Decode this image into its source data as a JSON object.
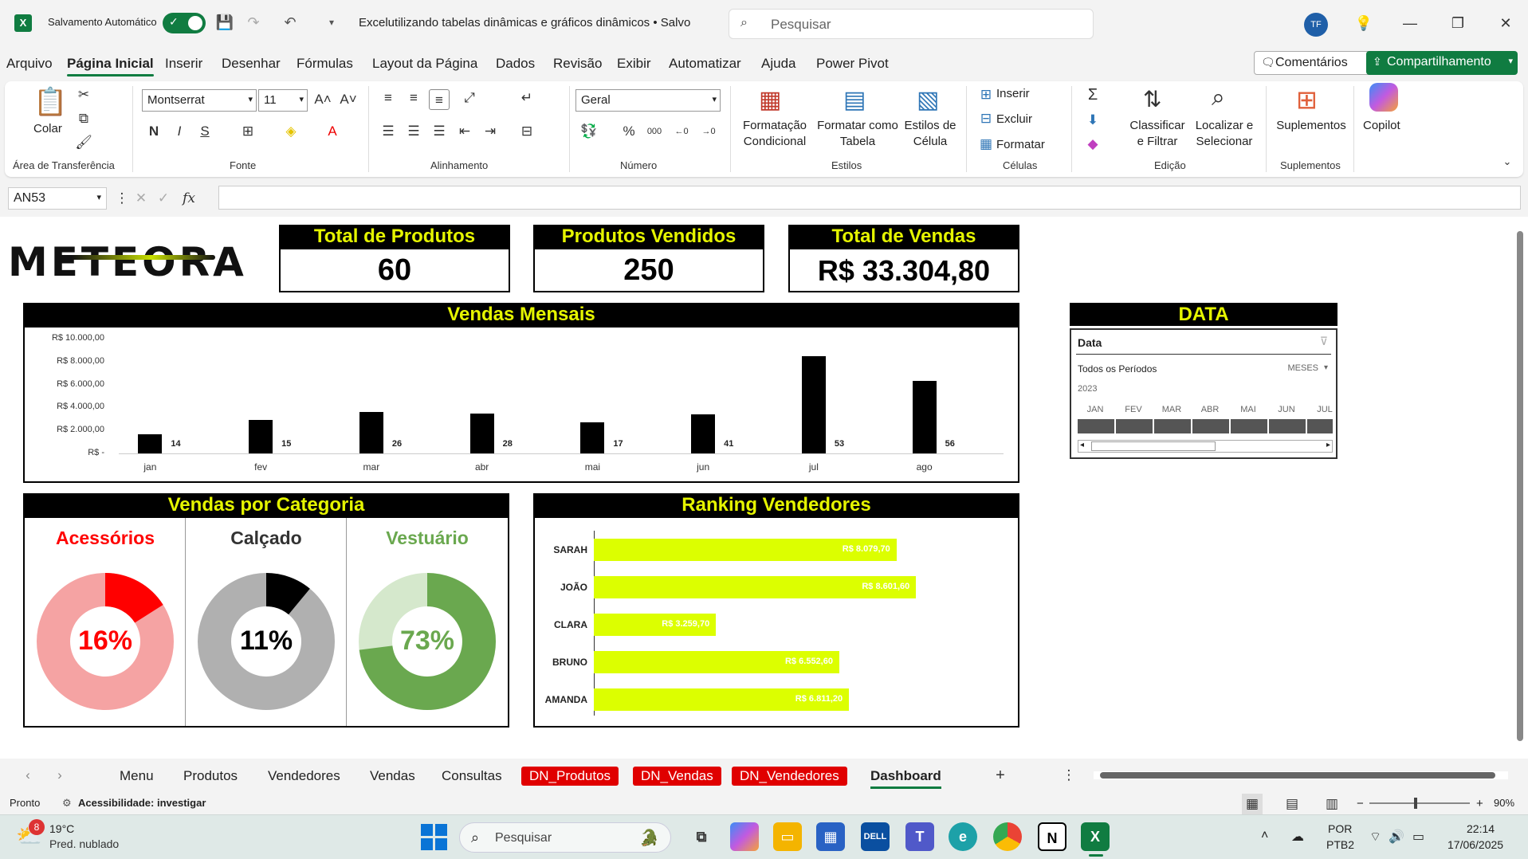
{
  "titlebar": {
    "autosave_label": "Salvamento Automático",
    "doc_title": "Excelutilizando tabelas dinâmicas e gráficos dinâmicos • Salvo",
    "search_placeholder": "Pesquisar",
    "avatar_initials": "TF"
  },
  "menu": {
    "items": [
      "Arquivo",
      "Página Inicial",
      "Inserir",
      "Desenhar",
      "Fórmulas",
      "Layout da Página",
      "Dados",
      "Revisão",
      "Exibir",
      "Automatizar",
      "Ajuda",
      "Power Pivot"
    ],
    "active": "Página Inicial",
    "comments_label": "Comentários",
    "share_label": "Compartilhamento"
  },
  "ribbon": {
    "paste_label": "Colar",
    "group_clipboard": "Área de Transferência",
    "font_name": "Montserrat",
    "font_size": "11",
    "group_font": "Fonte",
    "bold": "N",
    "italic": "I",
    "underline": "S",
    "group_alignment": "Alinhamento",
    "number_format": "Geral",
    "group_number": "Número",
    "cond_format": "Formatação Condicional",
    "format_table": "Formatar como Tabela",
    "cell_styles": "Estilos de Célula",
    "group_styles": "Estilos",
    "insert": "Inserir",
    "delete": "Excluir",
    "format": "Formatar",
    "group_cells": "Células",
    "sort_filter": "Classificar e Filtrar",
    "find_select": "Localizar e Selecionar",
    "group_editing": "Edição",
    "addins": "Suplementos",
    "group_addins": "Suplementos",
    "copilot": "Copilot"
  },
  "formula_bar": {
    "name_box": "AN53",
    "fx": "fx",
    "value": ""
  },
  "dashboard": {
    "logo": "METEORA",
    "kpis": [
      {
        "title": "Total de Produtos",
        "value": "60"
      },
      {
        "title": "Produtos Vendidos",
        "value": "250"
      },
      {
        "title": "Total de Vendas",
        "value": "R$ 33.304,80"
      }
    ],
    "monthly_title": "Vendas Mensais",
    "category_title": "Vendas por Categoria",
    "ranking_title": "Ranking Vendedores",
    "slicer_header": "DATA",
    "slicer": {
      "title": "Data",
      "all_periods": "Todos os Períodos",
      "level": "MESES",
      "year": "2023",
      "months": [
        "JAN",
        "FEV",
        "MAR",
        "ABR",
        "MAI",
        "JUN",
        "JUL"
      ]
    }
  },
  "chart_data": [
    {
      "type": "bar",
      "title": "Vendas Mensais",
      "categories": [
        "jan",
        "fev",
        "mar",
        "abr",
        "mai",
        "jun",
        "jul",
        "ago"
      ],
      "values": [
        1700,
        2950,
        3600,
        3500,
        2700,
        3400,
        8500,
        6300
      ],
      "data_labels": [
        "14",
        "15",
        "26",
        "28",
        "17",
        "41",
        "53",
        "56"
      ],
      "yticks": [
        "R$ -",
        "R$ 2.000,00",
        "R$ 4.000,00",
        "R$ 6.000,00",
        "R$ 8.000,00",
        "R$ 10.000,00"
      ],
      "ylim": [
        0,
        10000
      ],
      "bar_color": "#000000"
    },
    {
      "type": "pie",
      "title": "Vendas por Categoria",
      "slices": [
        {
          "name": "Acessórios",
          "value": 16,
          "label": "16%",
          "color": "#ff0000",
          "rest_color": "#f5a3a3"
        },
        {
          "name": "Calçado",
          "value": 11,
          "label": "11%",
          "color": "#000000",
          "rest_color": "#b0b0b0"
        },
        {
          "name": "Vestuário",
          "value": 73,
          "label": "73%",
          "color": "#6aa84f",
          "rest_color": "#d5e8cc"
        }
      ]
    },
    {
      "type": "bar",
      "title": "Ranking Vendedores",
      "categories": [
        "SARAH",
        "JOÃO",
        "CLARA",
        "BRUNO",
        "AMANDA"
      ],
      "values": [
        8079.7,
        8601.6,
        3259.7,
        6552.6,
        6811.2
      ],
      "data_labels": [
        "R$ 8.079,70",
        "R$ 8.601,60",
        "R$ 3.259,70",
        "R$ 6.552,60",
        "R$ 6.811,20"
      ],
      "xlim": [
        0,
        10000
      ],
      "bar_color": "#dcff00"
    }
  ],
  "tabs": {
    "items": [
      "Menu",
      "Produtos",
      "Vendedores",
      "Vendas",
      "Consultas",
      "DN_Produtos",
      "DN_Vendas",
      "DN_Vendedores",
      "Dashboard"
    ],
    "red": [
      "DN_Produtos",
      "DN_Vendas",
      "DN_Vendedores"
    ],
    "active": "Dashboard"
  },
  "status": {
    "ready": "Pronto",
    "accessibility": "Acessibilidade: investigar",
    "zoom": "90%"
  },
  "taskbar": {
    "weather_temp": "19°C",
    "weather_desc": "Pred. nublado",
    "weather_badge": "8",
    "search": "Pesquisar",
    "lang1": "POR",
    "lang2": "PTB2",
    "time": "22:14",
    "date": "17/06/2025"
  }
}
